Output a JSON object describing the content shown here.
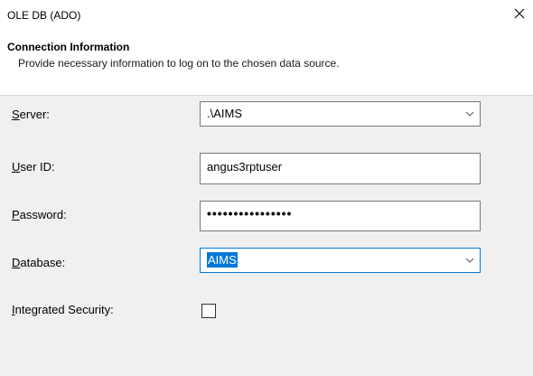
{
  "window": {
    "title": "OLE DB (ADO)",
    "close_icon": "close-icon"
  },
  "header": {
    "title": "Connection Information",
    "subtitle": "Provide necessary information to log on to the chosen data source."
  },
  "form": {
    "server": {
      "label_key": "S",
      "label_rest": "erver:",
      "value": ".\\AIMS"
    },
    "user_id": {
      "label_key": "U",
      "label_rest": "ser ID:",
      "value": "angus3rptuser"
    },
    "password": {
      "label_key": "P",
      "label_rest": "assword:",
      "value": "••••••••••••••••"
    },
    "database": {
      "label_key": "D",
      "label_rest": "atabase:",
      "value": "AIMS"
    },
    "integrated_security": {
      "label_key": "I",
      "label_rest": "ntegrated Security:",
      "checked": false
    }
  },
  "colors": {
    "accent": "#0078d7",
    "content_bg": "#f0f0f0"
  }
}
